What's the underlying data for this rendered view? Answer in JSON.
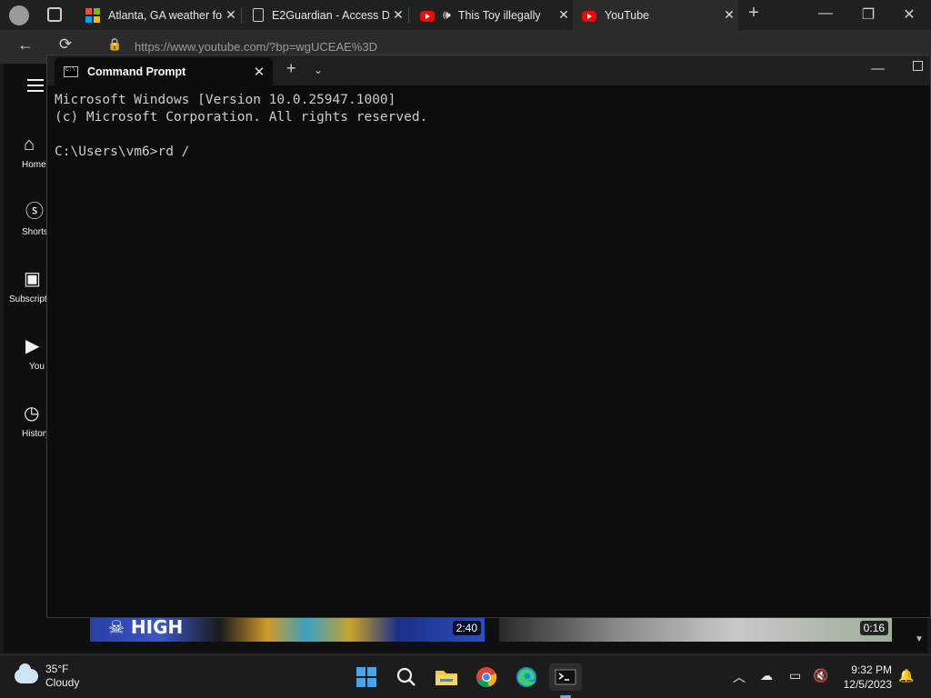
{
  "browser": {
    "tabs": [
      {
        "title": "Atlanta, GA weather fo",
        "favicon": "microsoft-icon"
      },
      {
        "title": "E2Guardian - Access D",
        "favicon": "document-icon"
      },
      {
        "title": "This Toy illegally",
        "favicon": "youtube-icon"
      },
      {
        "title": "YouTube",
        "favicon": "youtube-icon"
      }
    ],
    "url": "https://www.youtube.com/?bp=wgUCEAE%3D",
    "new_tab_symbol": "+"
  },
  "youtube": {
    "sidebar": [
      {
        "label": "Home",
        "icon": "home-icon"
      },
      {
        "label": "Shorts",
        "icon": "shorts-icon"
      },
      {
        "label": "Subscriptions",
        "icon": "subscriptions-icon"
      },
      {
        "label": "You",
        "icon": "library-icon"
      },
      {
        "label": "History",
        "icon": "history-icon"
      }
    ],
    "thumbnails": [
      {
        "duration": "2:40"
      },
      {
        "duration": "0:16"
      }
    ]
  },
  "terminal": {
    "tab_title": "Command Prompt",
    "lines": [
      "Microsoft Windows [Version 10.0.25947.1000]",
      "(c) Microsoft Corporation. All rights reserved.",
      "",
      "C:\\Users\\vm6>rd /"
    ]
  },
  "taskbar": {
    "weather": {
      "temp": "35°F",
      "condition": "Cloudy"
    },
    "clock": {
      "time": "9:32 PM",
      "date": "12/5/2023"
    },
    "apps": [
      "windows-start-icon",
      "search-icon",
      "file-explorer-icon",
      "chrome-icon",
      "edge-icon",
      "terminal-icon"
    ]
  },
  "colors": {
    "terminal_bg": "#0c0c0c",
    "terminal_text": "#cccccc",
    "youtube_red": "#ff0000"
  }
}
